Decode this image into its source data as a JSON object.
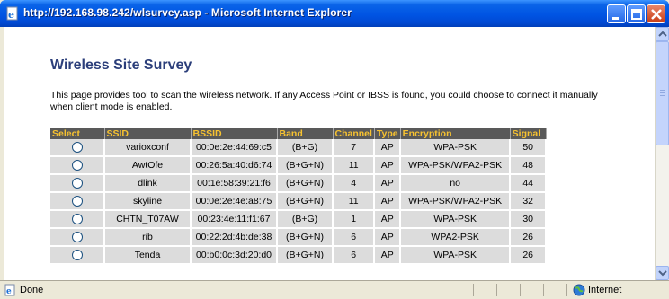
{
  "window": {
    "title": "http://192.168.98.242/wlsurvey.asp - Microsoft Internet Explorer"
  },
  "page": {
    "heading": "Wireless Site Survey",
    "description": "This page provides tool to scan the wireless network. If any Access Point or IBSS is found, you could choose to connect it manually when client mode is enabled."
  },
  "table": {
    "headers": [
      "Select",
      "SSID",
      "BSSID",
      "Band",
      "Channel",
      "Type",
      "Encryption",
      "Signal"
    ],
    "rows": [
      {
        "ssid": "varioxconf",
        "bssid": "00:0e:2e:44:69:c5",
        "band": "(B+G)",
        "channel": "7",
        "type": "AP",
        "encryption": "WPA-PSK",
        "signal": "50"
      },
      {
        "ssid": "AwtOfe",
        "bssid": "00:26:5a:40:d6:74",
        "band": "(B+G+N)",
        "channel": "11",
        "type": "AP",
        "encryption": "WPA-PSK/WPA2-PSK",
        "signal": "48"
      },
      {
        "ssid": "dlink",
        "bssid": "00:1e:58:39:21:f6",
        "band": "(B+G+N)",
        "channel": "4",
        "type": "AP",
        "encryption": "no",
        "signal": "44"
      },
      {
        "ssid": "skyline",
        "bssid": "00:0e:2e:4e:a8:75",
        "band": "(B+G+N)",
        "channel": "11",
        "type": "AP",
        "encryption": "WPA-PSK/WPA2-PSK",
        "signal": "32"
      },
      {
        "ssid": "CHTN_T07AW",
        "bssid": "00:23:4e:11:f1:67",
        "band": "(B+G)",
        "channel": "1",
        "type": "AP",
        "encryption": "WPA-PSK",
        "signal": "30"
      },
      {
        "ssid": "rib",
        "bssid": "00:22:2d:4b:de:38",
        "band": "(B+G+N)",
        "channel": "6",
        "type": "AP",
        "encryption": "WPA2-PSK",
        "signal": "26"
      },
      {
        "ssid": "Tenda",
        "bssid": "00:b0:0c:3d:20:d0",
        "band": "(B+G+N)",
        "channel": "6",
        "type": "AP",
        "encryption": "WPA-PSK",
        "signal": "26"
      }
    ]
  },
  "status": {
    "left_text": "Done",
    "zone_text": "Internet"
  },
  "colors": {
    "title_bar": "#0054e3",
    "heading": "#2b3e7a",
    "table_header_bg": "#595959",
    "table_header_text": "#f7c230",
    "table_cell_bg": "#dcdcdc"
  },
  "icons": {
    "title_icon": "ie-page-icon",
    "status_icon": "ie-page-icon",
    "zone_icon": "internet-globe-icon"
  }
}
